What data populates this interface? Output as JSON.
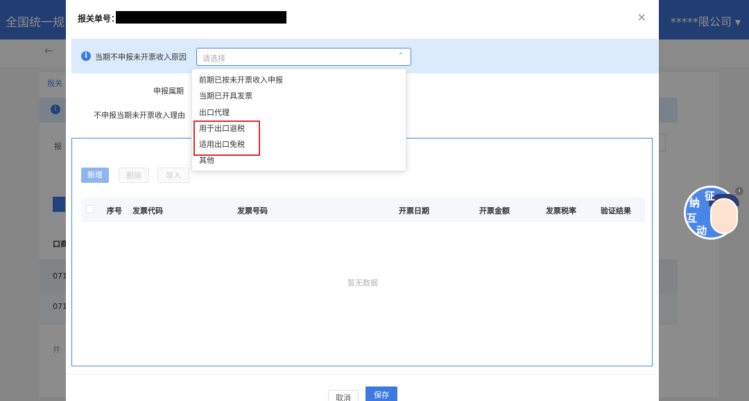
{
  "background": {
    "header_title": "全国统一规",
    "company": "*****限公司 ▾",
    "back_arrow": "←",
    "tab_label": "报关",
    "report_label": "报",
    "row_header": "口商",
    "row1_value": "071",
    "row2_value": "071",
    "row_side": "并"
  },
  "modal": {
    "title": "报关单号：",
    "close_icon": "×",
    "reason_bar": {
      "info_icon": "i",
      "label": "当期不申报未开票收入原因",
      "placeholder": "请选择",
      "chevron": "⌃"
    },
    "fields": {
      "period_label": "申报属期",
      "reason_label": "不申报当期未开票收入理由"
    },
    "dropdown": {
      "items": [
        "前期已按未开票收入申报",
        "当期已开具发票",
        "出口代理",
        "用于出口退税",
        "适用出口免税",
        "其他"
      ]
    },
    "table": {
      "buttons": {
        "add": "新增",
        "delete": "删除",
        "import": "导入"
      },
      "columns": [
        "序号",
        "发票代码",
        "发票号码",
        "开票日期",
        "开票金额",
        "发票税率",
        "验证结果"
      ],
      "empty_text": "暂无数据"
    },
    "footer": {
      "cancel": "取消",
      "save": "保存"
    }
  },
  "mascot": {
    "chars": [
      "纳",
      "征",
      "互",
      "动"
    ],
    "close": "‹"
  },
  "colors": {
    "accent": "#3e79e0",
    "highlight": "#e0282e",
    "info_bg": "#dcebfb"
  }
}
